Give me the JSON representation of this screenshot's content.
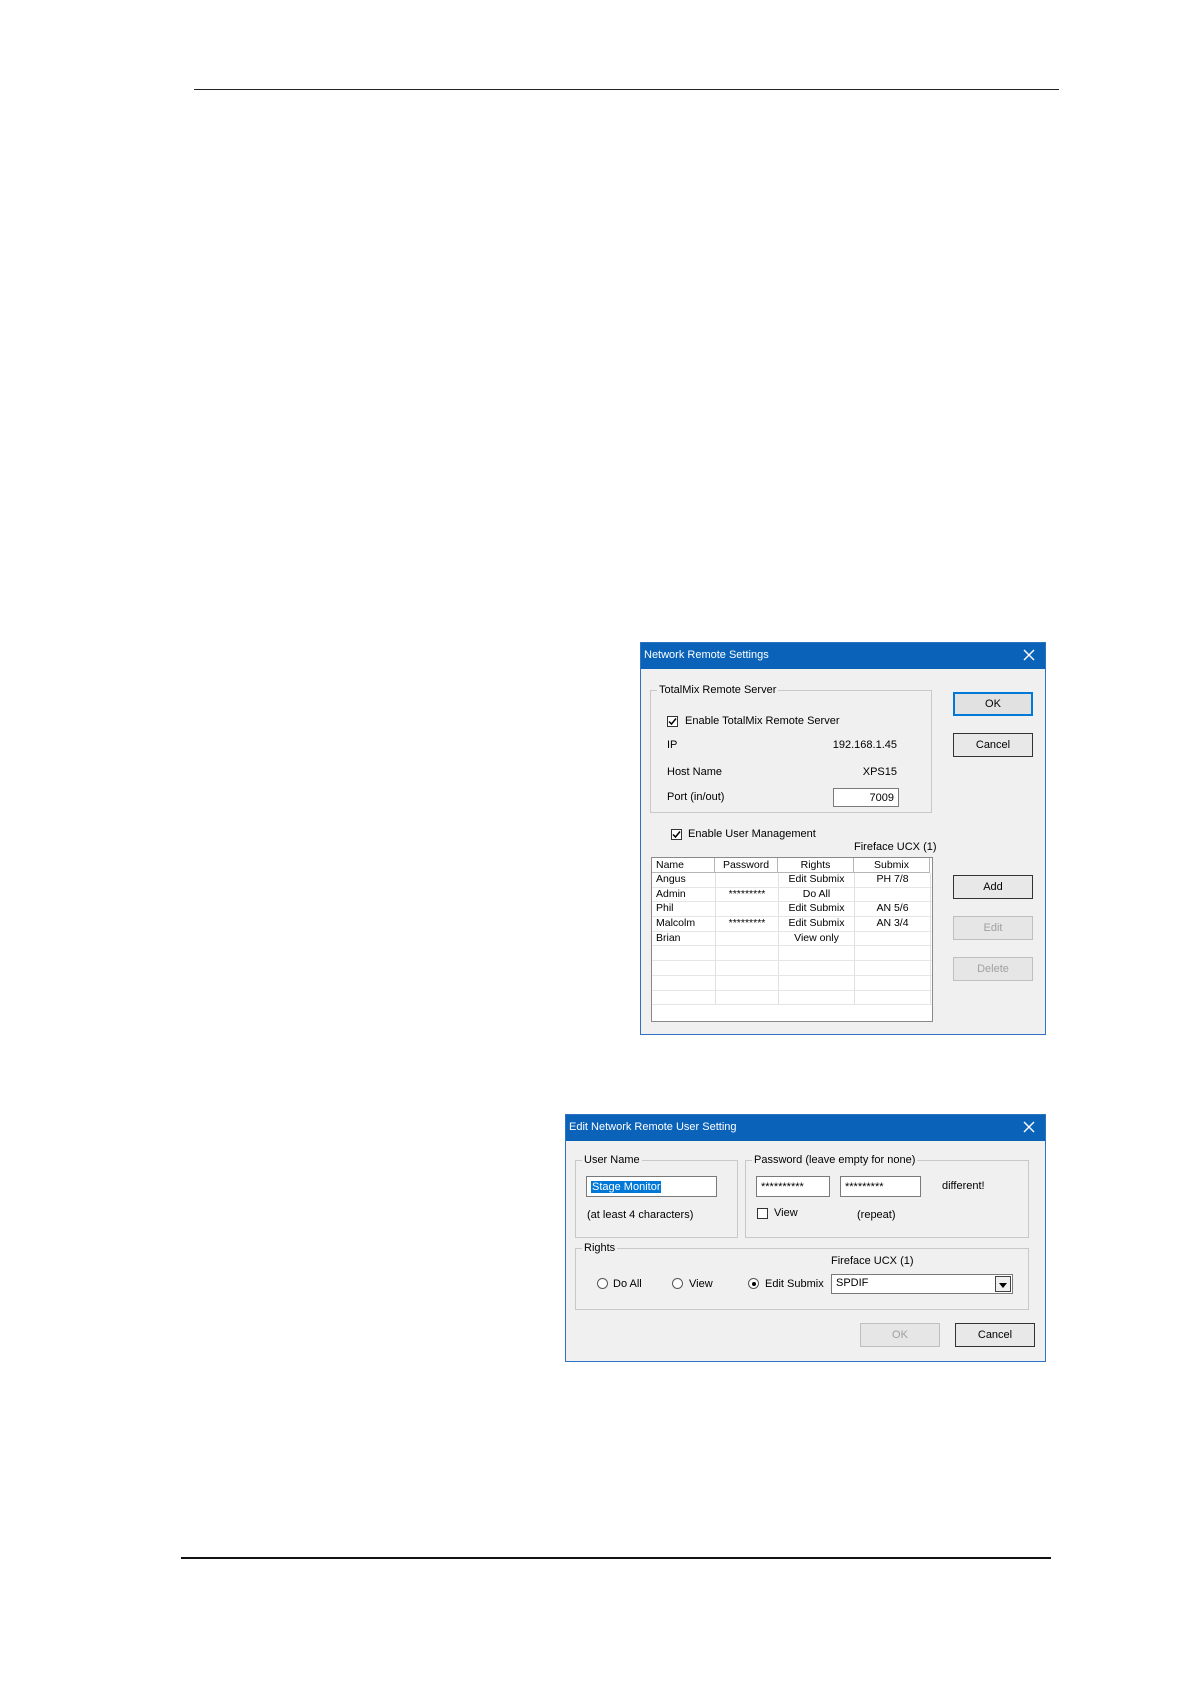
{
  "network_dialog": {
    "title": "Network Remote Settings",
    "server_group": "TotalMix Remote Server",
    "enable_server_label": "Enable TotalMix Remote Server",
    "enable_server_checked": true,
    "ip_label": "IP",
    "ip_value": "192.168.1.45",
    "host_label": "Host Name",
    "host_value": "XPS15",
    "port_label": "Port (in/out)",
    "port_value": "7009",
    "ok_label": "OK",
    "cancel_label": "Cancel",
    "enable_user_mgmt_label": "Enable User Management",
    "enable_user_mgmt_checked": true,
    "device_label": "Fireface UCX (1)",
    "columns": [
      "Name",
      "Password",
      "Rights",
      "Submix"
    ],
    "users": [
      {
        "name": "Angus",
        "password": "",
        "rights": "Edit Submix",
        "submix": "PH 7/8"
      },
      {
        "name": "Admin",
        "password": "*********",
        "rights": "Do All",
        "submix": ""
      },
      {
        "name": "Phil",
        "password": "",
        "rights": "Edit Submix",
        "submix": "AN 5/6"
      },
      {
        "name": "Malcolm",
        "password": "*********",
        "rights": "Edit Submix",
        "submix": "AN 3/4"
      },
      {
        "name": "Brian",
        "password": "",
        "rights": "View only",
        "submix": ""
      },
      {
        "name": "",
        "password": "",
        "rights": "",
        "submix": ""
      },
      {
        "name": "",
        "password": "",
        "rights": "",
        "submix": ""
      },
      {
        "name": "",
        "password": "",
        "rights": "",
        "submix": ""
      },
      {
        "name": "",
        "password": "",
        "rights": "",
        "submix": ""
      }
    ],
    "add_label": "Add",
    "edit_label": "Edit",
    "delete_label": "Delete"
  },
  "edit_dialog": {
    "title": "Edit Network Remote User Setting",
    "username_group": "User Name",
    "username_value": "Stage Monitor",
    "username_hint": "(at least 4 characters)",
    "password_group": "Password (leave empty for none)",
    "password_value": "**********",
    "password_repeat_value": "*********",
    "password_status": "different!",
    "view_label": "View",
    "view_checked": false,
    "repeat_label": "(repeat)",
    "rights_group": "Rights",
    "device_label": "Fireface UCX (1)",
    "right_options": [
      "Do All",
      "View",
      "Edit Submix"
    ],
    "selected_right": "Edit Submix",
    "submix_value": "SPDIF",
    "ok_label": "OK",
    "cancel_label": "Cancel"
  },
  "colors": {
    "titlebar": "#0a63b8",
    "dialog_bg": "#f0f0f0",
    "selection": "#0078d7"
  }
}
